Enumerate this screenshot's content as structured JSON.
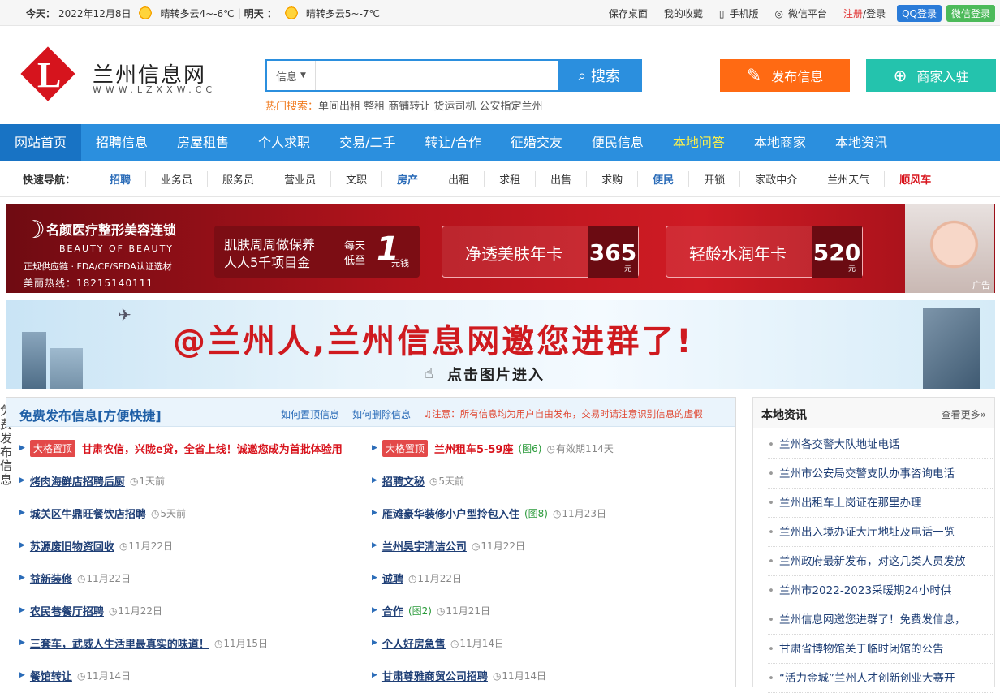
{
  "topbar": {
    "today_label": "今天：",
    "date": "2022年12月8日",
    "weather_today": "晴转多云4~-6℃",
    "divider": "|",
    "tomorrow_label": "明天 ：",
    "weather_tomorrow": "晴转多云5~-7℃",
    "links": [
      "保存桌面",
      "我的收藏",
      "手机版",
      "微信平台"
    ],
    "register": "注册",
    "slash": "/",
    "login": "登录",
    "qq_login": "QQ登录",
    "wechat_login": "微信登录"
  },
  "header": {
    "site_name": "兰州信息网",
    "site_url": "WWW.LZXXW.CC",
    "search_category": "信息",
    "search_button": "搜索",
    "hot_label": "热门搜索：",
    "hot_terms": "单间出租 整租 商铺转让 货运司机 公安指定兰州",
    "publish_button": "发布信息",
    "merchant_button": "商家入驻"
  },
  "nav": {
    "items": [
      "网站首页",
      "招聘信息",
      "房屋租售",
      "个人求职",
      "交易/二手",
      "转让/合作",
      "征婚交友",
      "便民信息",
      "本地问答",
      "本地商家",
      "本地资讯"
    ],
    "colors": {
      "bar": "#2b8fde",
      "active": "#1873c4",
      "highlight": "#fff24a"
    }
  },
  "quick_nav": {
    "title": "快速导航：",
    "items": [
      "招聘",
      "业务员",
      "服务员",
      "营业员",
      "文职",
      "房产",
      "出租",
      "求租",
      "出售",
      "求购",
      "便民",
      "开锁",
      "家政中介",
      "兰州天气",
      "顺风车"
    ]
  },
  "ad1": {
    "brand": "名颜医疗整形美容连锁",
    "brand_en": "BEAUTY OF BEAUTY",
    "brand_sub": "正规供应链 · FDA/CE/SFDA认证选材",
    "tel": "美丽热线：18215140111",
    "promo_line1": "肌肤周周做保养",
    "promo_line2": "人人5千项目金",
    "promo_mid1": "每天",
    "promo_mid2": "低至",
    "promo_price": "1",
    "promo_unit": "元钱",
    "card1_text": "净透美肤年卡",
    "card1_price": "365",
    "card2_text": "轻龄水润年卡",
    "card2_price": "520",
    "yuan": "元",
    "ad_tag": "广告"
  },
  "ad2": {
    "headline": "@兰州人,兰州信息网邀您进群了!",
    "sub": "点击图片进入"
  },
  "free_publish": {
    "title": "免费发布信息[方便快捷]",
    "link_top": "如何置顶信息",
    "link_delete": "如何删除信息",
    "warning": "♫注意：所有信息均为用户自由发布，交易时请注意识别信息的虚假",
    "side_label": "免费发布信息",
    "left": [
      {
        "badge": "大格置顶",
        "title": "甘肃农信，兴陇e贷，全省上线！诚邀您成为首批体验用",
        "red": true
      },
      {
        "title": "烤肉海鲜店招聘后厨",
        "time": "1天前"
      },
      {
        "title": "城关区牛鼎旺餐饮店招聘",
        "time": "5天前"
      },
      {
        "title": "苏源废旧物资回收",
        "time": "11月22日"
      },
      {
        "title": "益新装修",
        "time": "11月22日"
      },
      {
        "title": "农民巷餐厅招聘",
        "time": "11月22日"
      },
      {
        "title": "三套车，武威人生活里最真实的味道！",
        "time": "11月15日"
      },
      {
        "title": "餐馆转让",
        "time": "11月14日"
      }
    ],
    "right": [
      {
        "badge": "大格置顶",
        "title": "兰州租车5-59座",
        "img": "(图6)",
        "time": "有效期114天",
        "red": true
      },
      {
        "title": "招聘文秘",
        "time": "5天前"
      },
      {
        "title": "雁滩豪华装修小户型拎包入住",
        "img": "(图8)",
        "time": "11月23日"
      },
      {
        "title": "兰州昊宇清洁公司",
        "time": "11月22日"
      },
      {
        "title": "诚聘",
        "time": "11月22日"
      },
      {
        "title": "合作",
        "img": "(图2)",
        "time": "11月21日"
      },
      {
        "title": "个人好房急售",
        "time": "11月14日"
      },
      {
        "title": "甘肃尊雅商贸公司招聘",
        "time": "11月14日"
      }
    ]
  },
  "local_news": {
    "title": "本地资讯",
    "more": "查看更多»",
    "items": [
      "兰州各交警大队地址电话",
      "兰州市公安局交警支队办事咨询电话",
      "兰州出租车上岗证在那里办理",
      "兰州出入境办证大厅地址及电话一览",
      "兰州政府最新发布，对这几类人员发放",
      "兰州市2022-2023采暖期24小时供",
      "兰州信息网邀您进群了！免费发信息，",
      "甘肃省博物馆关于临时闭馆的公告",
      "“活力金城”兰州人才创新创业大赛开"
    ]
  }
}
